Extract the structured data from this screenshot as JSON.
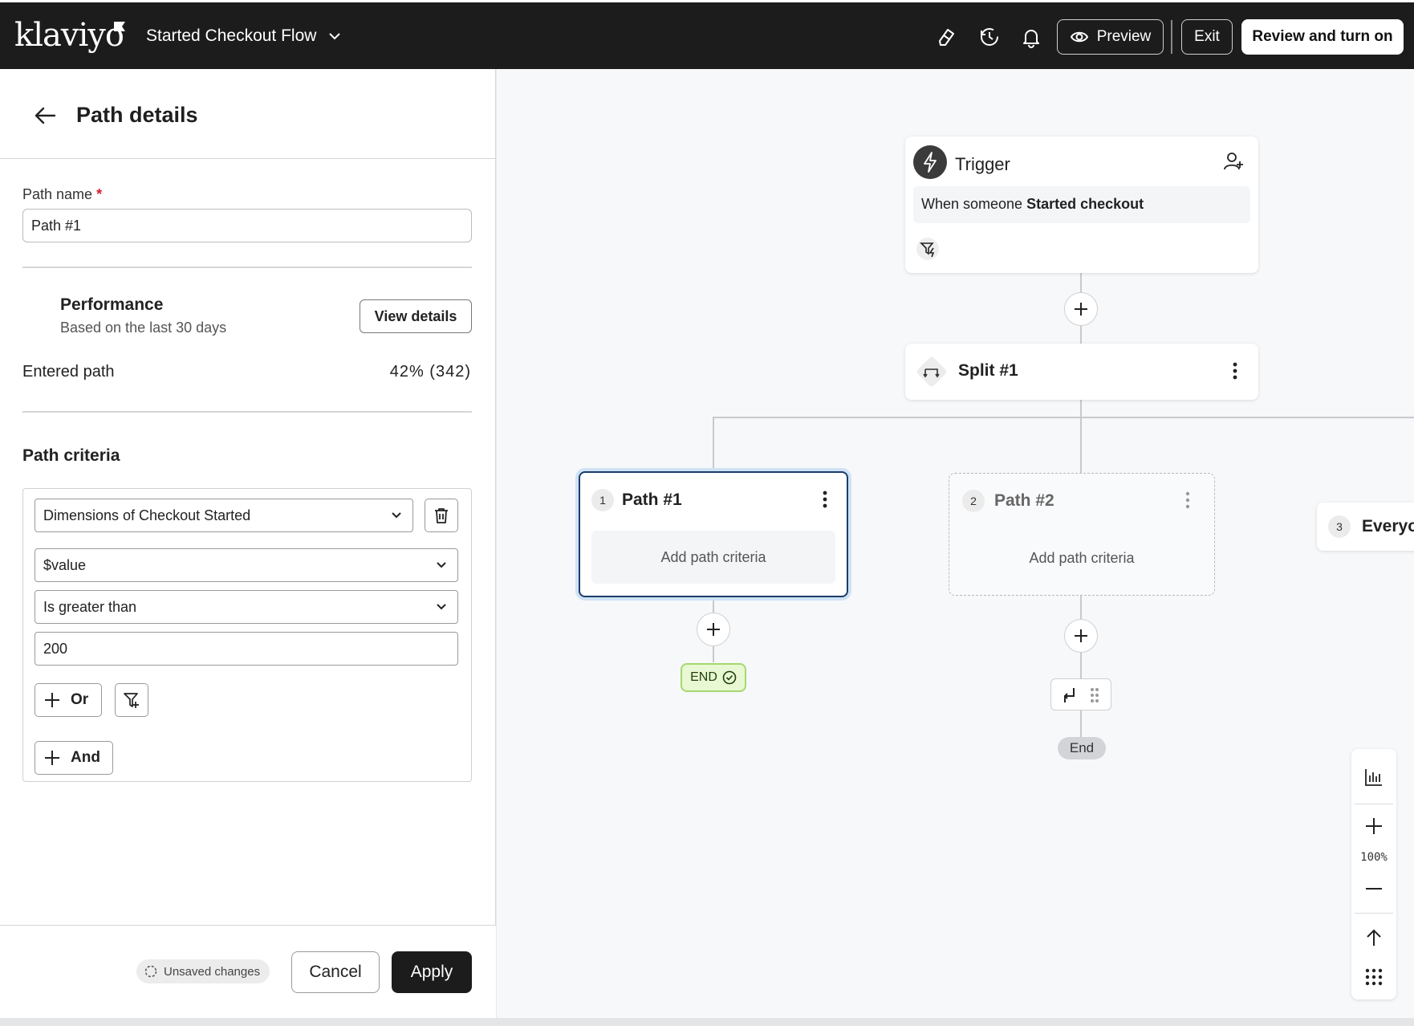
{
  "app": {
    "logo": "klaviyo",
    "flow_title": "Started Checkout Flow"
  },
  "topbar": {
    "preview_label": "Preview",
    "exit_label": "Exit",
    "review_label": "Review and turn on"
  },
  "panel": {
    "title": "Path details",
    "path_name_label": "Path name",
    "path_name_required": "*",
    "path_name_value": "Path #1",
    "performance_title": "Performance",
    "performance_sub": "Based on the last 30 days",
    "view_details_label": "View details",
    "entered_label": "Entered path",
    "entered_value": "42% (342)",
    "criteria_title": "Path criteria",
    "criteria": {
      "dimension": "Dimensions of Checkout Started",
      "property": "$value",
      "operator": "Is greater than",
      "value": "200",
      "or_label": "Or",
      "and_label": "And"
    },
    "footer": {
      "unsaved_label": "Unsaved changes",
      "cancel_label": "Cancel",
      "apply_label": "Apply"
    }
  },
  "canvas": {
    "trigger": {
      "title": "Trigger",
      "body_prefix": "When someone ",
      "body_event": "Started checkout"
    },
    "split": {
      "title": "Split #1"
    },
    "paths": [
      {
        "num": "1",
        "title": "Path #1",
        "body": "Add path criteria"
      },
      {
        "num": "2",
        "title": "Path #2",
        "body": "Add path criteria"
      },
      {
        "num": "3",
        "title": "Everyo"
      }
    ],
    "end_label": "END",
    "end_label_2": "End",
    "zoom": "100%"
  },
  "colors": {
    "topbar_bg": "#1c1c1c",
    "selected_border": "#1d4f91",
    "end_green_bg": "#e8f8d2",
    "required_red": "#d21f2e"
  }
}
